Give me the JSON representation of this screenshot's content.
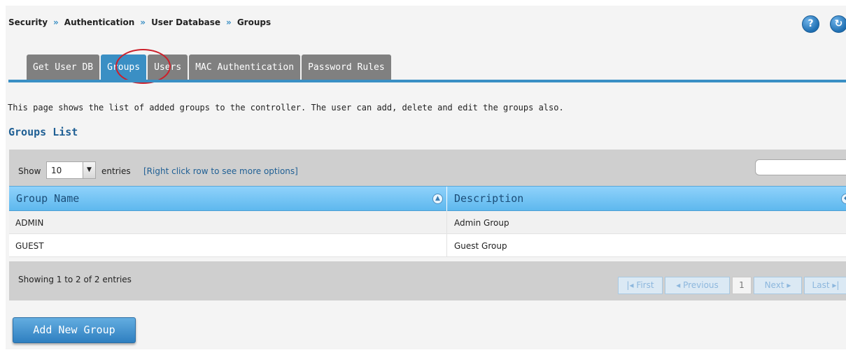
{
  "breadcrumb": {
    "items": [
      "Security",
      "Authentication",
      "User Database",
      "Groups"
    ],
    "separator": "»"
  },
  "header_icons": {
    "help_glyph": "?",
    "help_icon_name": "help-icon",
    "refresh_glyph": "↻",
    "refresh_icon_name": "refresh-icon"
  },
  "tabs": [
    {
      "label": "Get User DB",
      "active": false
    },
    {
      "label": "Groups",
      "active": true
    },
    {
      "label": "Users",
      "active": false
    },
    {
      "label": "MAC Authentication",
      "active": false
    },
    {
      "label": "Password Rules",
      "active": false
    }
  ],
  "description": "This page shows the list of added groups to the controller. The user can add, delete and edit the groups also.",
  "list_title": "Groups List",
  "toolbar": {
    "show_label": "Show",
    "entries_value": "10",
    "entries_label": "entries",
    "hint": "[Right click row to see more options]",
    "search_value": ""
  },
  "table": {
    "columns": [
      "Group Name",
      "Description"
    ],
    "rows": [
      {
        "group": "ADMIN",
        "description": "Admin Group"
      },
      {
        "group": "GUEST",
        "description": "Guest Group"
      }
    ]
  },
  "footer": {
    "showing": "Showing 1 to 2 of 2 entries",
    "pager": {
      "first": "First",
      "previous": "Previous",
      "page": "1",
      "next": "Next",
      "last": "Last"
    }
  },
  "actions": {
    "add_group": "Add New Group"
  },
  "colors": {
    "accent": "#3a8fc4",
    "tab_inactive": "#808080",
    "table_header": "#5eb8ee",
    "highlight_circle": "#cc1f2a",
    "title_text": "#1f5f94"
  }
}
